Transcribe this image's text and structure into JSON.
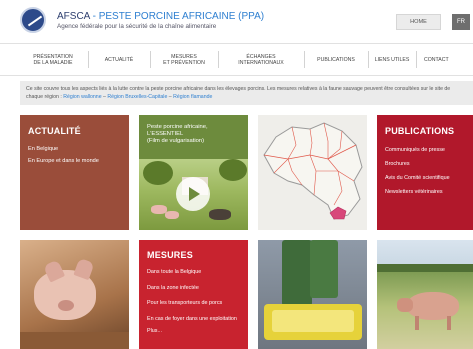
{
  "header": {
    "org": "AFSCA",
    "separator": " - ",
    "title": "PESTE PORCINE AFRICAINE (PPA)",
    "subtitle": "Agence fédérale pour la sécurité de la chaîne alimentaire",
    "home_label": "HOME",
    "lang_label": "FR"
  },
  "nav": [
    {
      "line1": "PRÉSENTATION",
      "line2": "DE LA MALADIE"
    },
    {
      "line1": "ACTUALITÉ",
      "line2": ""
    },
    {
      "line1": "MESURES",
      "line2": "ET PRÉVENTION"
    },
    {
      "line1": "ÉCHANGES",
      "line2": "INTERNATIONAUX"
    },
    {
      "line1": "PUBLICATIONS",
      "line2": ""
    },
    {
      "line1": "LIENS UTILES",
      "line2": ""
    },
    {
      "line1": "CONTACT",
      "line2": ""
    }
  ],
  "info": {
    "text": "Ce site couvre tous les aspects liés à la lutte contre la peste porcine africaine dans les élevages porcins. Les mesures relatives à la faune sauvage peuvent être consultées sur le site de chaque région :",
    "link1": "Région wallonne",
    "dash1": " – ",
    "link2": "Région Bruxelles-Capitale",
    "dash2": " – ",
    "link3": "Région flamande"
  },
  "actualite": {
    "title": "ACTUALITÉ",
    "links": [
      "En Belgique",
      "En Europe et dans le monde"
    ]
  },
  "video": {
    "caption_line1": "Peste porcine africaine,",
    "caption_line2": "L'ESSENTIEL",
    "caption_line3": "(Film de vulgarisation)"
  },
  "publications": {
    "title": "PUBLICATIONS",
    "links": [
      "Communiqués de presse",
      "Brochures",
      "Avis du Comité scientifique",
      "Newsletters vétérinaires"
    ]
  },
  "mesures": {
    "title": "MESURES",
    "links": [
      "Dans toute la Belgique",
      "Dans la zone infectée",
      "Pour les transporteurs de porcs",
      "En cas de foyer dans une exploitation",
      "Plus..."
    ]
  },
  "colors": {
    "actualite_bg": "#9a4d3a",
    "video_bg": "#6d8b3d",
    "publications_bg": "#b1182b",
    "mesures_bg": "#c8232f",
    "link_blue": "#2e7fd0",
    "map_infected_zone": "#d8477a"
  },
  "icons": {
    "logo": "afsca-logo-icon",
    "play": "play-icon"
  }
}
